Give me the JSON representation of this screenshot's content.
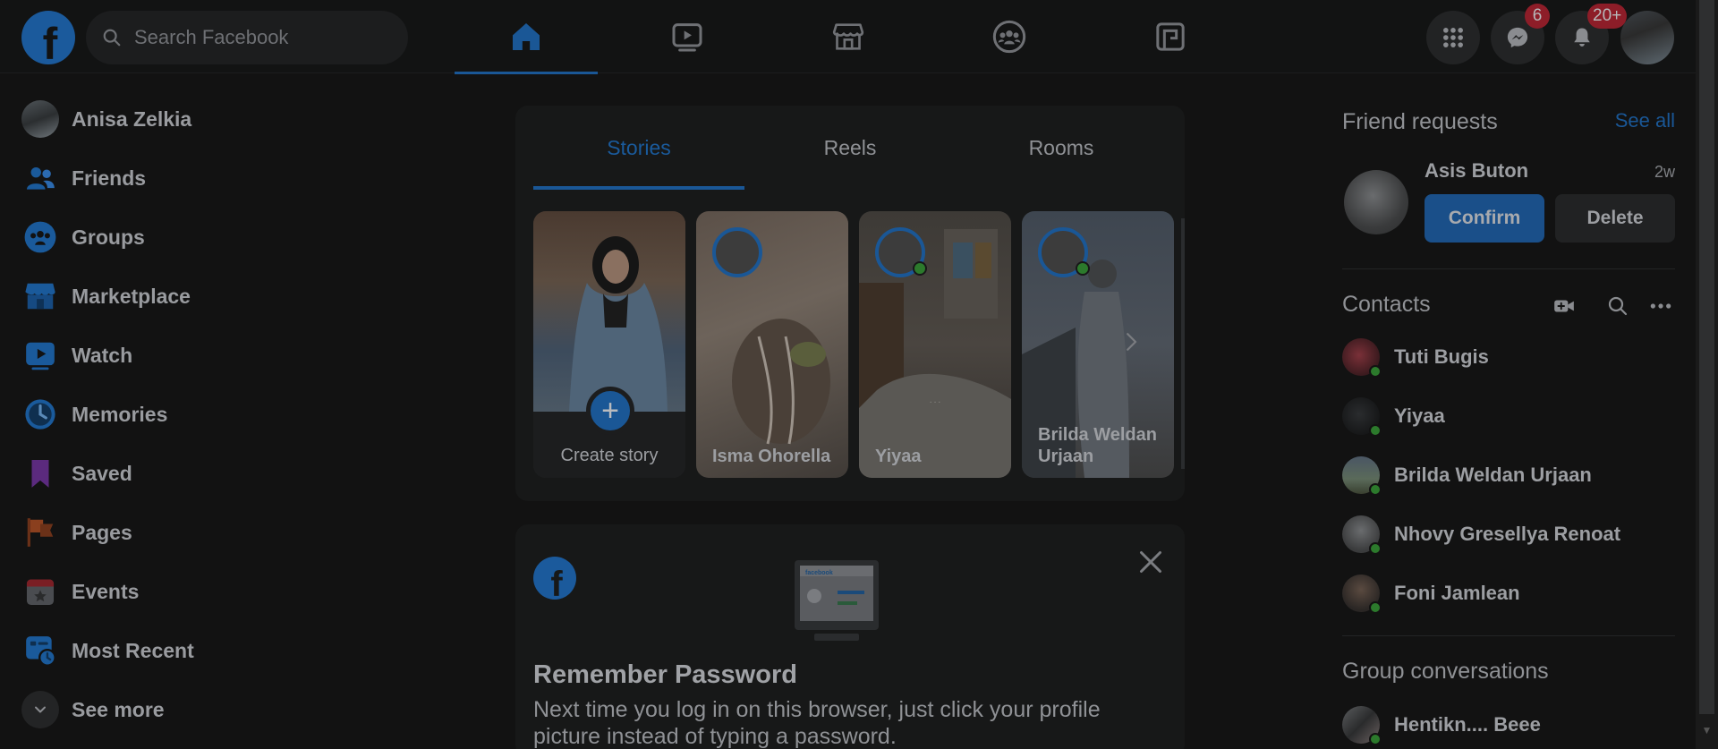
{
  "header": {
    "logo_glyph": "f",
    "search_placeholder": "Search Facebook",
    "nav_tabs": [
      {
        "name": "home",
        "icon": "home-icon",
        "active": true
      },
      {
        "name": "watch",
        "icon": "video-icon",
        "active": false
      },
      {
        "name": "marketplace",
        "icon": "store-icon",
        "active": false
      },
      {
        "name": "groups",
        "icon": "groups-icon",
        "active": false
      },
      {
        "name": "gaming",
        "icon": "gaming-icon",
        "active": false
      }
    ],
    "messenger_badge": "6",
    "notifications_badge": "20+"
  },
  "left_nav": {
    "profile_name": "Anisa Zelkia",
    "items": [
      {
        "label": "Friends",
        "icon": "friends-icon"
      },
      {
        "label": "Groups",
        "icon": "groups-icon"
      },
      {
        "label": "Marketplace",
        "icon": "marketplace-icon"
      },
      {
        "label": "Watch",
        "icon": "watch-icon"
      },
      {
        "label": "Memories",
        "icon": "memories-icon"
      },
      {
        "label": "Saved",
        "icon": "saved-icon"
      },
      {
        "label": "Pages",
        "icon": "pages-icon"
      },
      {
        "label": "Events",
        "icon": "events-icon"
      },
      {
        "label": "Most Recent",
        "icon": "most-recent-icon"
      }
    ],
    "see_more": "See more"
  },
  "stories": {
    "tabs": [
      "Stories",
      "Reels",
      "Rooms"
    ],
    "active_tab": "Stories",
    "create_label": "Create story",
    "items": [
      {
        "name": "Isma Ohorella"
      },
      {
        "name": "Yiyaa"
      },
      {
        "name": "Brilda Weldan Urjaan"
      }
    ]
  },
  "password_card": {
    "title": "Remember Password",
    "text": "Next time you log in on this browser, just click your profile picture instead of typing a password."
  },
  "friend_requests": {
    "heading": "Friend requests",
    "see_all": "See all",
    "request": {
      "name": "Asis Buton",
      "time": "2w",
      "confirm": "Confirm",
      "delete": "Delete"
    }
  },
  "contacts": {
    "heading": "Contacts",
    "list": [
      {
        "name": "Tuti Bugis"
      },
      {
        "name": "Yiyaa"
      },
      {
        "name": "Brilda Weldan Urjaan"
      },
      {
        "name": "Nhovy Gresellya Renoat"
      },
      {
        "name": "Foni Jamlean"
      }
    ]
  },
  "group_conversations": {
    "heading": "Group conversations",
    "list": [
      {
        "name": "Hentikn.... Beee"
      }
    ]
  },
  "colors": {
    "background": "#121212",
    "accent": "#1a5796",
    "badge": "#8d1d28",
    "online": "#2c7a2c"
  }
}
